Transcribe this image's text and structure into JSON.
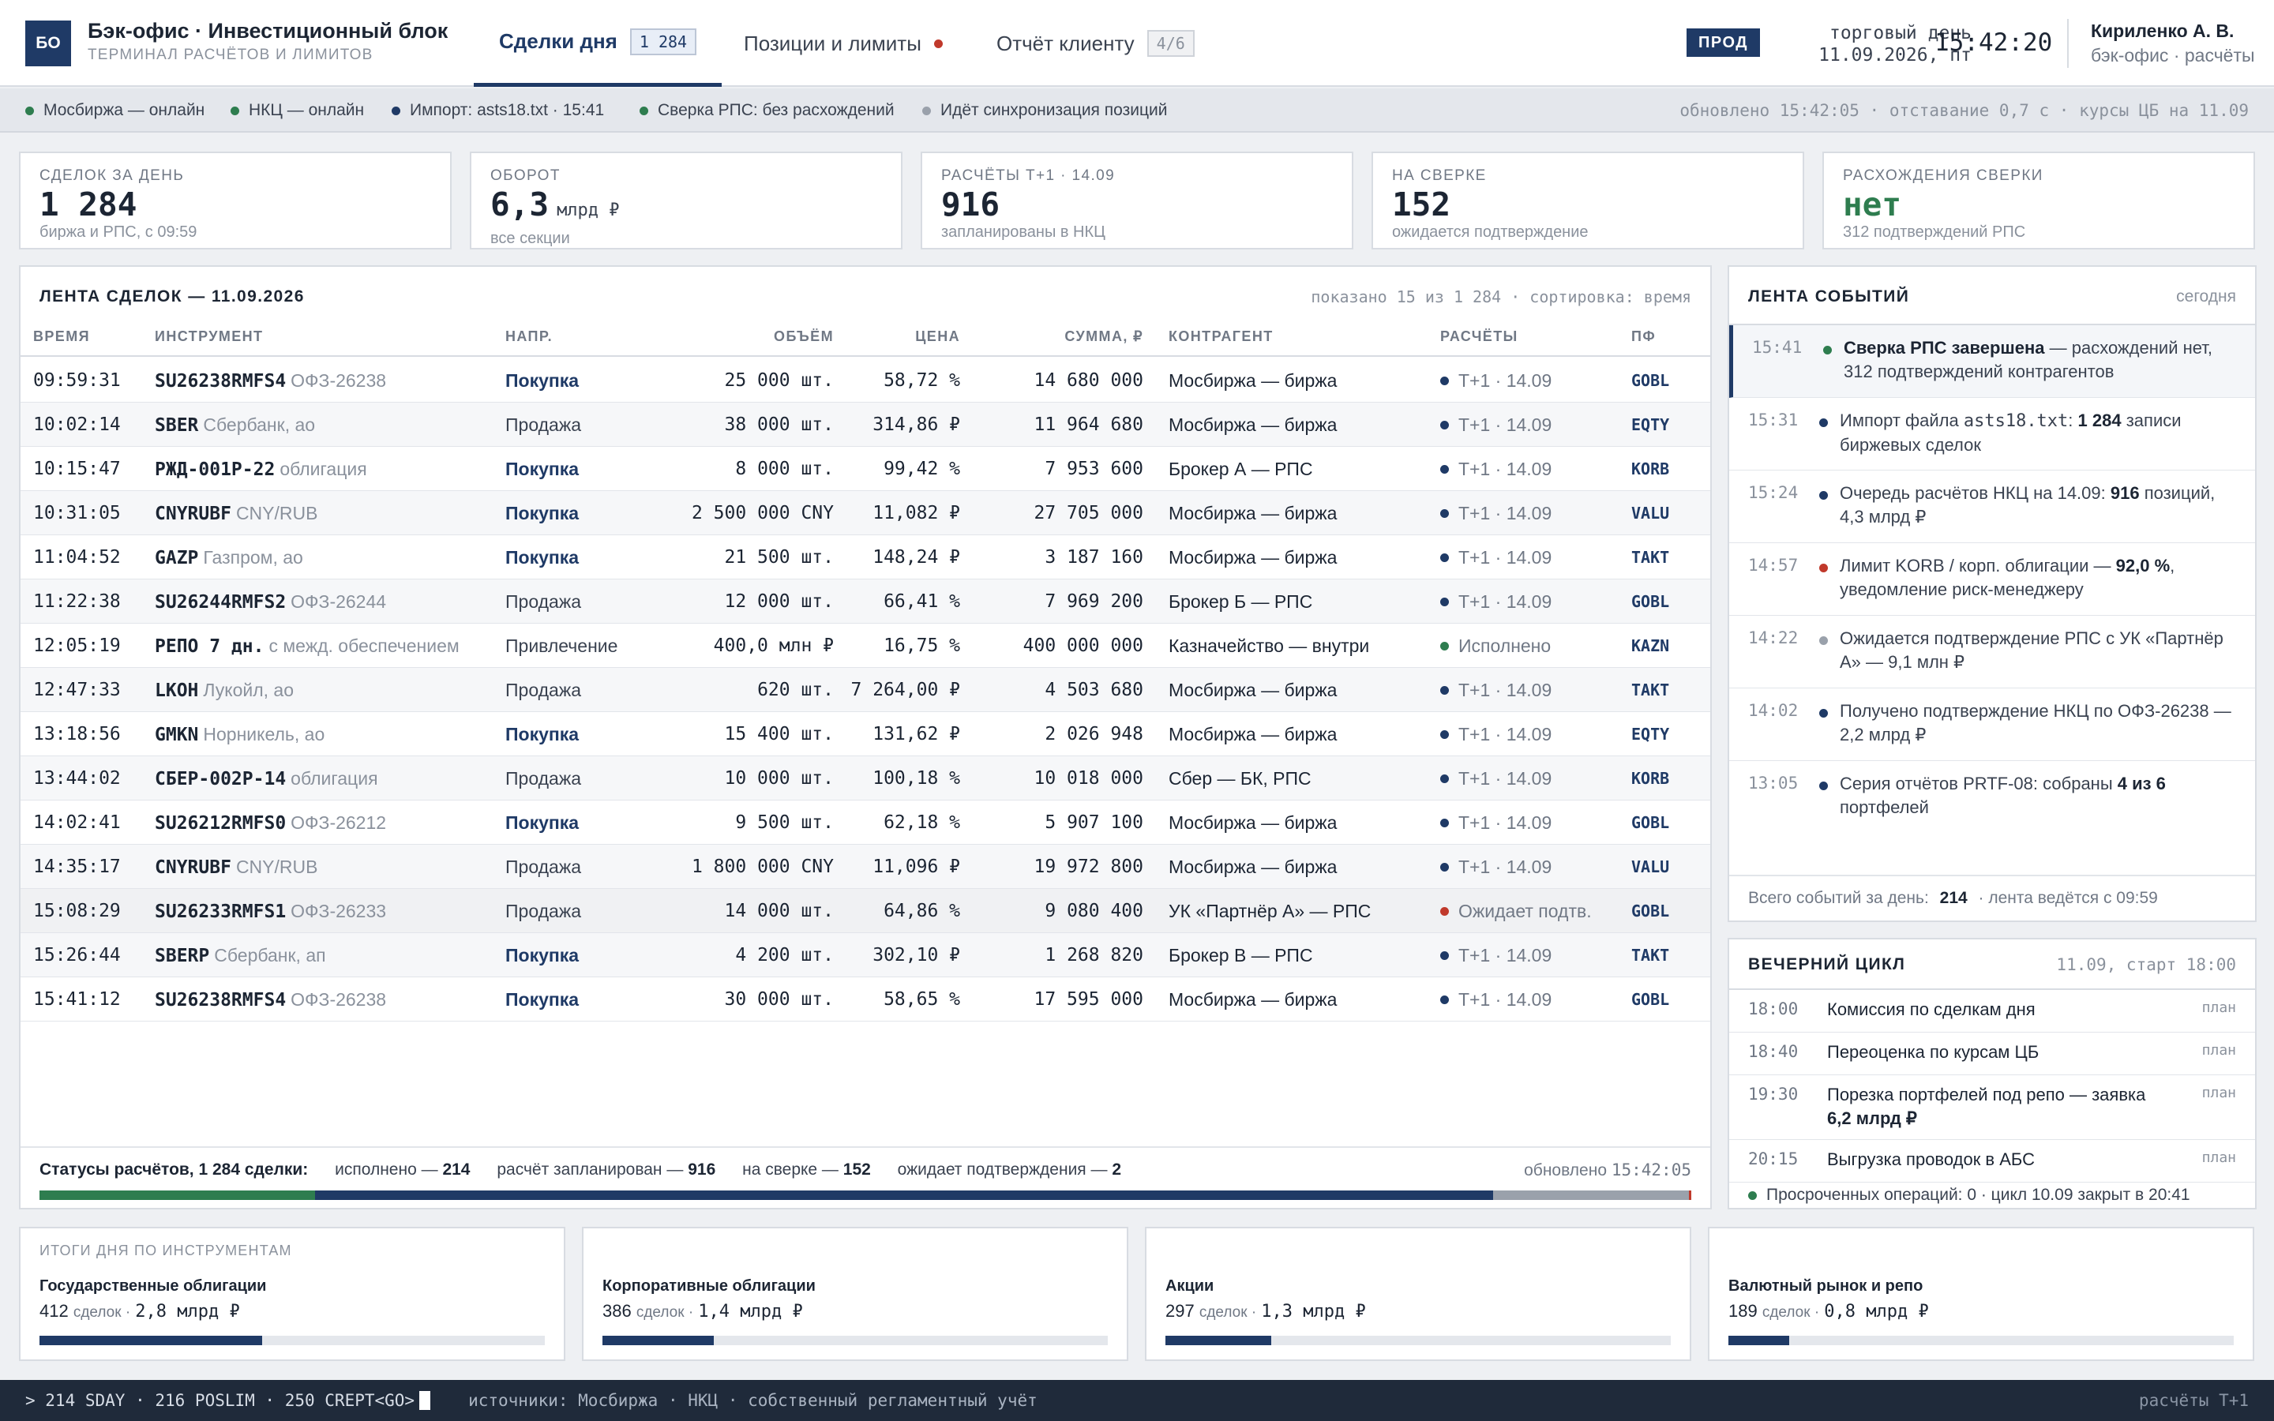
{
  "header": {
    "logo": "БО",
    "title": "Бэк-офис · Инвестиционный блок",
    "subtitle": "ТЕРМИНАЛ РАСЧЁТОВ И ЛИМИТОВ",
    "tabs": [
      {
        "label": "Сделки дня",
        "badge": "1 284"
      },
      {
        "label": "Позиции и лимиты"
      },
      {
        "label": "Отчёт клиенту",
        "badge": "4/6"
      }
    ],
    "env": "ПРОД",
    "trading_day_label": "торговый день",
    "trading_day": "11.09.2026, пт",
    "clock": "15:42:20",
    "user": "Кириленко А. В.",
    "user_role": "бэк-офис · расчёты"
  },
  "status": {
    "items": [
      {
        "label": "Мосбиржа — онлайн",
        "color": "#2e7d4f"
      },
      {
        "label": "НКЦ — онлайн",
        "color": "#2e7d4f"
      },
      {
        "label": "Импорт: asts18.txt · 15:41",
        "color": "#1f3a66"
      },
      {
        "label": "Сверка РПС: без расхождений",
        "color": "#2e7d4f"
      },
      {
        "label": "Идёт синхронизация позиций",
        "color": "#9aa1ab"
      }
    ],
    "right": "обновлено 15:42:05 · отставание 0,7 с · курсы ЦБ на 11.09"
  },
  "kpis": [
    {
      "label": "СДЕЛОК ЗА ДЕНЬ",
      "value": "1 284",
      "unit": "",
      "sub": "биржа и РПС, с 09:59"
    },
    {
      "label": "ОБОРОТ",
      "value": "6,3",
      "unit": "млрд ₽",
      "sub": "все секции"
    },
    {
      "label": "РАСЧЁТЫ Т+1 · 14.09",
      "value": "916",
      "unit": "",
      "sub": "запланированы в НКЦ"
    },
    {
      "label": "НА СВЕРКЕ",
      "value": "152",
      "unit": "",
      "sub": "ожидается подтверждение"
    },
    {
      "label": "РАСХОЖДЕНИЯ СВЕРКИ",
      "value": "нет",
      "unit": "",
      "sub": "312 подтверждений РПС"
    }
  ],
  "deals": {
    "title": "ЛЕНТА СДЕЛОК — 11.09.2026",
    "meta": "показано 15 из 1 284 · сортировка: время",
    "columns": [
      "ВРЕМЯ",
      "ИНСТРУМЕНТ",
      "НАПР.",
      "ОБЪЁМ",
      "ЦЕНА",
      "СУММА, ₽",
      "КОНТРАГЕНТ",
      "РАСЧЁТЫ",
      "ПФ"
    ],
    "rows": [
      {
        "time": "09:59:31",
        "code": "SU26238RMFS4",
        "name": "ОФЗ-26238",
        "dir": "Покупка",
        "vol": "25 000 шт.",
        "price": "58,72 %",
        "sum": "14 680 000",
        "cp": "Мосбиржа — биржа",
        "settle": "Т+1 · 14.09",
        "settle_color": "#1f3a66",
        "pf": "GOBL"
      },
      {
        "time": "10:02:14",
        "code": "SBER",
        "name": "Сбербанк, ао",
        "dir": "Продажа",
        "vol": "38 000 шт.",
        "price": "314,86 ₽",
        "sum": "11 964 680",
        "cp": "Мосбиржа — биржа",
        "settle": "Т+1 · 14.09",
        "settle_color": "#1f3a66",
        "pf": "EQTY"
      },
      {
        "time": "10:15:47",
        "code": "РЖД-001Р-22",
        "name": "облигация",
        "dir": "Покупка",
        "vol": "8 000 шт.",
        "price": "99,42 %",
        "sum": "7 953 600",
        "cp": "Брокер А — РПС",
        "settle": "Т+1 · 14.09",
        "settle_color": "#1f3a66",
        "pf": "KORB"
      },
      {
        "time": "10:31:05",
        "code": "CNYRUBF",
        "name": "CNY/RUB",
        "dir": "Покупка",
        "vol": "2 500 000 CNY",
        "price": "11,082 ₽",
        "sum": "27 705 000",
        "cp": "Мосбиржа — биржа",
        "settle": "Т+1 · 14.09",
        "settle_color": "#1f3a66",
        "pf": "VALU"
      },
      {
        "time": "11:04:52",
        "code": "GAZP",
        "name": "Газпром, ао",
        "dir": "Покупка",
        "vol": "21 500 шт.",
        "price": "148,24 ₽",
        "sum": "3 187 160",
        "cp": "Мосбиржа — биржа",
        "settle": "Т+1 · 14.09",
        "settle_color": "#1f3a66",
        "pf": "TAKT"
      },
      {
        "time": "11:22:38",
        "code": "SU26244RMFS2",
        "name": "ОФЗ-26244",
        "dir": "Продажа",
        "vol": "12 000 шт.",
        "price": "66,41 %",
        "sum": "7 969 200",
        "cp": "Брокер Б — РПС",
        "settle": "Т+1 · 14.09",
        "settle_color": "#1f3a66",
        "pf": "GOBL"
      },
      {
        "time": "12:05:19",
        "code": "РЕПО 7 дн.",
        "name": "с межд. обеспечением",
        "dir": "Привлечение",
        "vol": "400,0 млн ₽",
        "price": "16,75 %",
        "sum": "400 000 000",
        "cp": "Казначейство — внутри",
        "settle": "Исполнено",
        "settle_color": "#2e7d4f",
        "pf": "KAZN"
      },
      {
        "time": "12:47:33",
        "code": "LKOH",
        "name": "Лукойл, ао",
        "dir": "Продажа",
        "vol": "620 шт.",
        "price": "7 264,00 ₽",
        "sum": "4 503 680",
        "cp": "Мосбиржа — биржа",
        "settle": "Т+1 · 14.09",
        "settle_color": "#1f3a66",
        "pf": "TAKT"
      },
      {
        "time": "13:18:56",
        "code": "GMKN",
        "name": "Норникель, ао",
        "dir": "Покупка",
        "vol": "15 400 шт.",
        "price": "131,62 ₽",
        "sum": "2 026 948",
        "cp": "Мосбиржа — биржа",
        "settle": "Т+1 · 14.09",
        "settle_color": "#1f3a66",
        "pf": "EQTY"
      },
      {
        "time": "13:44:02",
        "code": "СБЕР-002Р-14",
        "name": "облигация",
        "dir": "Продажа",
        "vol": "10 000 шт.",
        "price": "100,18 %",
        "sum": "10 018 000",
        "cp": "Сбер — БК, РПС",
        "settle": "Т+1 · 14.09",
        "settle_color": "#1f3a66",
        "pf": "KORB"
      },
      {
        "time": "14:02:41",
        "code": "SU26212RMFS0",
        "name": "ОФЗ-26212",
        "dir": "Покупка",
        "vol": "9 500 шт.",
        "price": "62,18 %",
        "sum": "5 907 100",
        "cp": "Мосбиржа — биржа",
        "settle": "Т+1 · 14.09",
        "settle_color": "#1f3a66",
        "pf": "GOBL"
      },
      {
        "time": "14:35:17",
        "code": "CNYRUBF",
        "name": "CNY/RUB",
        "dir": "Продажа",
        "vol": "1 800 000 CNY",
        "price": "11,096 ₽",
        "sum": "19 972 800",
        "cp": "Мосбиржа — биржа",
        "settle": "Т+1 · 14.09",
        "settle_color": "#1f3a66",
        "pf": "VALU"
      },
      {
        "time": "15:08:29",
        "code": "SU26233RMFS1",
        "name": "ОФЗ-26233",
        "dir": "Продажа",
        "vol": "14 000 шт.",
        "price": "64,86 %",
        "sum": "9 080 400",
        "cp": "УК «Партнёр А» — РПС",
        "settle": "Ожидает подтв.",
        "settle_color": "#c0392b",
        "pf": "GOBL"
      },
      {
        "time": "15:26:44",
        "code": "SBERP",
        "name": "Сбербанк, ап",
        "dir": "Покупка",
        "vol": "4 200 шт.",
        "price": "302,10 ₽",
        "sum": "1 268 820",
        "cp": "Брокер В — РПС",
        "settle": "Т+1 · 14.09",
        "settle_color": "#1f3a66",
        "pf": "TAKT"
      },
      {
        "time": "15:41:12",
        "code": "SU26238RMFS4",
        "name": "ОФЗ-26238",
        "dir": "Покупка",
        "vol": "30 000 шт.",
        "price": "58,65 %",
        "sum": "17 595 000",
        "cp": "Мосбиржа — биржа",
        "settle": "Т+1 · 14.09",
        "settle_color": "#1f3a66",
        "pf": "GOBL"
      }
    ],
    "footer": {
      "label": "Статусы расчётов, 1 284 сделки:",
      "segments": [
        {
          "text": "исполнено —",
          "value": "214",
          "color": "#2e7d4f"
        },
        {
          "text": "расчёт запланирован —",
          "value": "916",
          "color": "#1f3a66"
        },
        {
          "text": "на сверке —",
          "value": "152",
          "color": "#9aa1ab"
        },
        {
          "text": "ожидает подтверждения —",
          "value": "2",
          "color": "#c0392b"
        }
      ],
      "updated_label": "обновлено",
      "updated": "15:42:05"
    }
  },
  "events": {
    "title": "ЛЕНТА СОБЫТИЙ",
    "scope": "сегодня",
    "items": [
      {
        "time": "15:41",
        "color": "#2e7d4f",
        "bold": "Сверка РПС завершена",
        "text": " — расхождений нет, 312 подтверждений контрагентов"
      },
      {
        "time": "15:31",
        "color": "#1f3a66",
        "text": "Импорт файла asts18.txt: ",
        "bold": "1 284",
        "tail": " записи биржевых сделок"
      },
      {
        "time": "15:24",
        "color": "#1f3a66",
        "text": "Очередь расчётов НКЦ на 14.09: ",
        "bold": "916",
        "tail": " позиций, 4,3 млрд ₽"
      },
      {
        "time": "14:57",
        "color": "#c0392b",
        "text": "Лимит KORB / корп. облигации — ",
        "bold": "92,0 %",
        "tail": ", уведомление риск-менеджеру"
      },
      {
        "time": "14:22",
        "color": "#9aa1ab",
        "text": "Ожидается подтверждение РПС с УК «Партнёр А» — 9,1 млн ₽"
      },
      {
        "time": "14:02",
        "color": "#1f3a66",
        "text": "Получено подтверждение НКЦ по ОФЗ-26238 — 2,2 млрд ₽"
      },
      {
        "time": "13:05",
        "color": "#1f3a66",
        "text": "Серия отчётов PRTF-08: собраны ",
        "bold": "4 из 6",
        "tail": " портфелей"
      }
    ],
    "footer_label": "Всего событий за день:",
    "footer_count": "214",
    "footer_tail": "· лента ведётся с 09:59"
  },
  "evening": {
    "title": "ВЕЧЕРНИЙ ЦИКЛ",
    "meta": "11.09, старт 18:00",
    "items": [
      {
        "time": "18:00",
        "text": "Комиссия по сделкам дня",
        "status": "план"
      },
      {
        "time": "18:40",
        "text": "Переоценка по курсам ЦБ",
        "status": "план"
      },
      {
        "time": "19:30",
        "text": "Порезка портфелей под репо — заявка ",
        "bold": "6,2 млрд ₽",
        "status": "план"
      },
      {
        "time": "20:15",
        "text": "Выгрузка проводок в АБС",
        "status": "план"
      }
    ],
    "footer": "Просроченных операций: 0 · цикл 10.09 закрыт в 20:41"
  },
  "totals": {
    "title": "ИТОГИ ДНЯ ПО ИНСТРУМЕНТАМ",
    "items": [
      {
        "name": "Государственные облигации",
        "count": "412",
        "count_unit": "сделок ·",
        "amount": "2,8 млрд ₽",
        "share": 0.44
      },
      {
        "name": "Корпоративные облигации",
        "count": "386",
        "count_unit": "сделок ·",
        "amount": "1,4 млрд ₽",
        "share": 0.22
      },
      {
        "name": "Акции",
        "count": "297",
        "count_unit": "сделок ·",
        "amount": "1,3 млрд ₽",
        "share": 0.21
      },
      {
        "name": "Валютный рынок и репо",
        "count": "189",
        "count_unit": "сделок ·",
        "amount": "0,8 млрд ₽",
        "share": 0.12
      }
    ]
  },
  "terminal": {
    "command": "> 214 SDAY · 216 POSLIM · 250 CREPT<GO>",
    "sources": "источники: Мосбиржа · НКЦ · собственный регламентный учёт",
    "right": "расчёты Т+1"
  }
}
